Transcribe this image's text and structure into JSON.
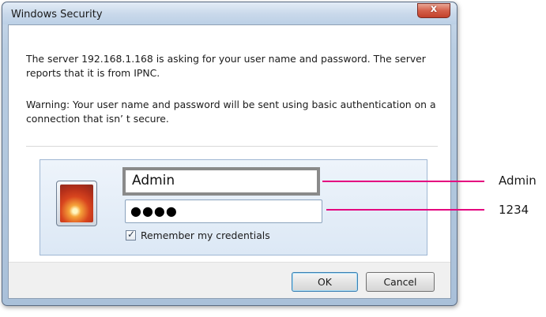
{
  "window": {
    "title": "Windows Security",
    "close_label": "x"
  },
  "message": {
    "line1": "The server 192.168.1.168 is asking for your user name and password. The server reports that it is from IPNC.",
    "line2": "Warning: Your user name and password will be sent using basic authentication on a connection that isn’ t secure."
  },
  "credentials": {
    "username_value": "Admin",
    "password_masked": "●●●●",
    "remember_checked": true,
    "remember_label": "Remember my credentials"
  },
  "buttons": {
    "ok_label": "OK",
    "cancel_label": "Cancel"
  },
  "callouts": {
    "username": "Admin",
    "password": "1234"
  },
  "colors": {
    "callout_line": "#e4007f",
    "window_frame": "#b9cde2",
    "close_button": "#d4604a"
  }
}
